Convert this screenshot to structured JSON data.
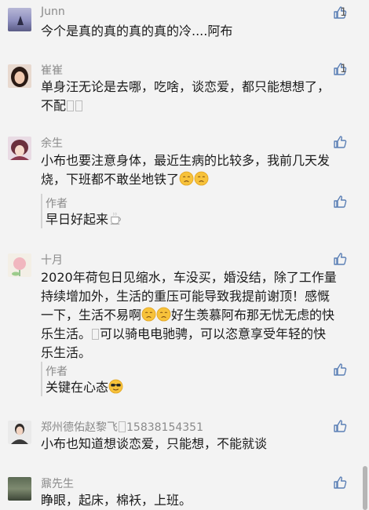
{
  "comments": [
    {
      "name": "Junn",
      "text": "今个是真的真的真的真的冷....阿布",
      "likes": "1"
    },
    {
      "name": "崔崔",
      "text_line1": "单身汪无论是去哪，吃啥，谈恋爱，都只能想想了，",
      "text_line2": "不配",
      "likes": "1"
    },
    {
      "name": "余生",
      "text_line1": "小布也要注意身体，最近生病的比较多，我前几天发",
      "text_line2": "烧，下班都不敢坐地铁了",
      "reply": {
        "name": "作者",
        "text": "早日好起来"
      }
    },
    {
      "name": "十月",
      "text_line1": "2020年荷包日见缩水，车没买，婚没结，除了工作量",
      "text_line2": "持续增加外，生活的重压可能导致我提前谢顶！感慨",
      "text_line3a": "一下，生活不易啊",
      "text_line3b": "好生羡慕阿布那无忧无虑的快",
      "text_line4": "乐生活。",
      "text_line4b": "可以骑电电驰骋，可以恣意享受年轻的快",
      "text_line5": "乐生活。",
      "reply": {
        "name": "作者",
        "text": "关键在心态"
      }
    },
    {
      "name": "郑州德佑赵黎飞",
      "name_suffix": "15838154351",
      "text": "小布也知道想谈恋爱，只能想，不能就谈"
    },
    {
      "name": "鼐先生",
      "text": "睁眼，起床，棉袄，上班。"
    }
  ],
  "colors": {
    "background": "#f3f3f3",
    "name": "#8a8a8a",
    "text": "#1a1a1a",
    "icon": "#5b7fb5"
  },
  "icons": [
    "thumbs-up-icon",
    "coffee-emoji",
    "pensive-emoji",
    "sunglasses-emoji"
  ]
}
